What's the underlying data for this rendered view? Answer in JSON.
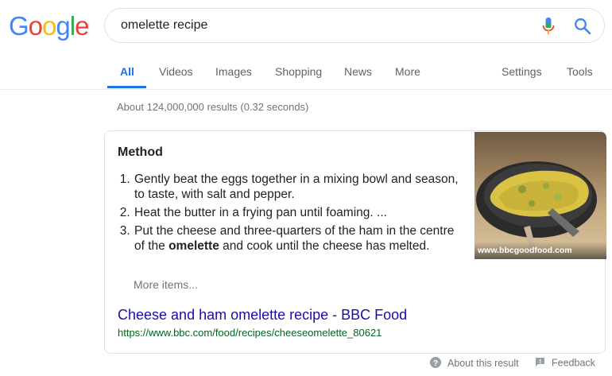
{
  "logo": {
    "letters": [
      "G",
      "o",
      "o",
      "g",
      "l",
      "e"
    ],
    "colors": [
      "#4285f4",
      "#ea4335",
      "#fbbc05",
      "#4285f4",
      "#34a853",
      "#ea4335"
    ]
  },
  "search": {
    "query": "omelette recipe"
  },
  "icons": {
    "mic": "mic-icon",
    "search": "search-icon",
    "help": "help-circle-icon",
    "feedback": "feedback-icon"
  },
  "tabs": {
    "all": "All",
    "videos": "Videos",
    "images": "Images",
    "shopping": "Shopping",
    "news": "News",
    "more": "More",
    "settings": "Settings",
    "tools": "Tools"
  },
  "stats": "About 124,000,000 results (0.32 seconds)",
  "snippet": {
    "title": "Method",
    "steps": [
      {
        "text": "Gently beat the eggs together in a mixing bowl and season, to taste, with salt and pepper."
      },
      {
        "text": "Heat the butter in a frying pan until foaming. ..."
      },
      {
        "before": "Put the cheese and three-quarters of the ham in the centre of the ",
        "bold": "omelette",
        "after": " and cook until the cheese has melted."
      }
    ],
    "more_items": "More items...",
    "link_title": "Cheese and ham omelette recipe - BBC Food",
    "url": "https://www.bbc.com/food/recipes/cheeseomelette_80621",
    "image_source": "www.bbcgoodfood.com"
  },
  "footer": {
    "about": "About this result",
    "feedback": "Feedback"
  },
  "colors": {
    "accent": "#1a73e8",
    "link": "#1a0dab",
    "url": "#006621",
    "muted": "#70757a"
  }
}
